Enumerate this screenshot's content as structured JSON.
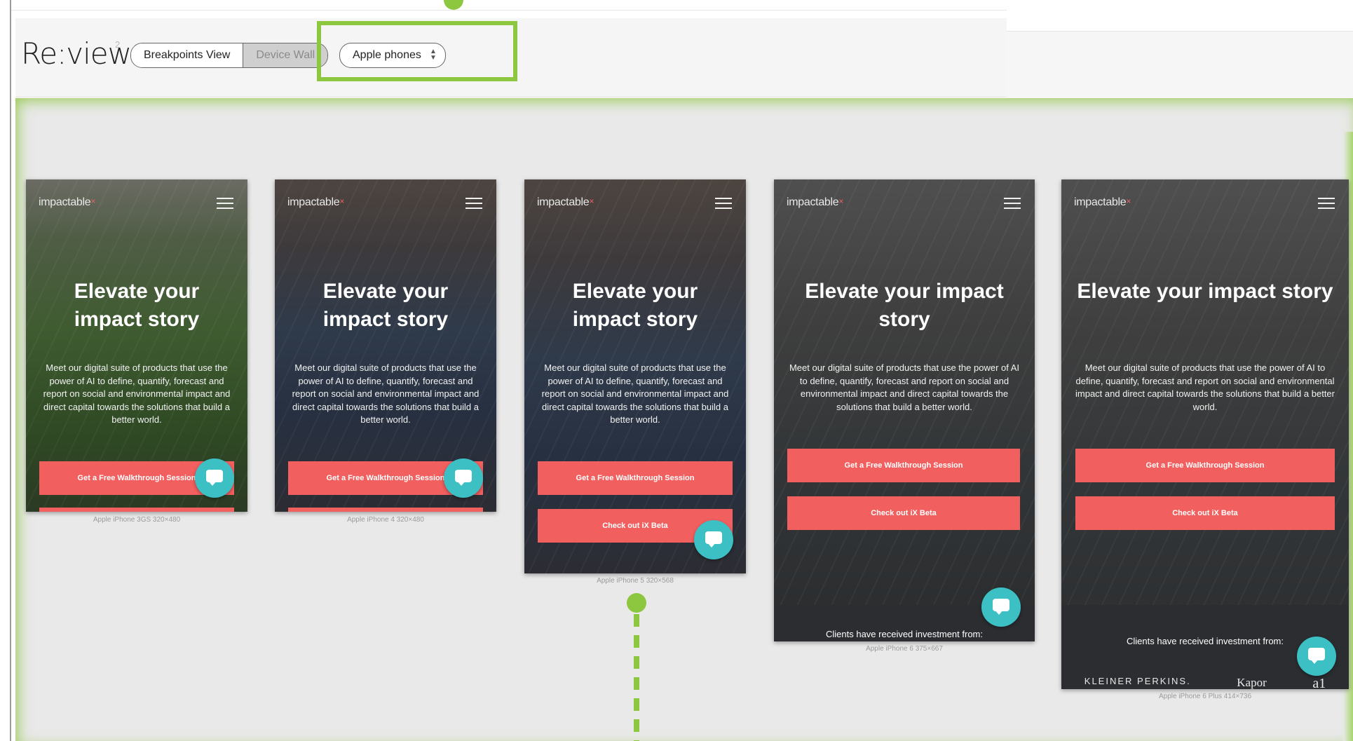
{
  "app": {
    "title": "Re:view",
    "sup": "2"
  },
  "view_toggle": {
    "option_a": "Breakpoints View",
    "option_b": "Device Wall"
  },
  "device_filter": {
    "value": "Apple phones"
  },
  "devices": [
    {
      "brand": "impactable",
      "brand_mark": "×",
      "headline": "Elevate your impact story",
      "body": "Meet our digital suite of products that use the power of AI to define, quantify, forecast and report on social and environmental impact and direct capital towards the solutions that build a better world.",
      "cta_primary": "Get a Free Walkthrough Session",
      "caption": "Apple iPhone 3GS   320×480"
    },
    {
      "brand": "impactable",
      "brand_mark": "×",
      "headline": "Elevate your impact story",
      "body": "Meet our digital suite of products that use the power of AI to define, quantify, forecast and report on social and environmental impact and direct capital towards the solutions that build a better world.",
      "cta_primary": "Get a Free Walkthrough Session",
      "caption": "Apple iPhone 4   320×480"
    },
    {
      "brand": "impactable",
      "brand_mark": "×",
      "headline": "Elevate your impact story",
      "body": "Meet our digital suite of products that use the power of AI to define, quantify, forecast and report on social and environmental impact and direct capital towards the solutions that build a better world.",
      "cta_primary": "Get a Free Walkthrough Session",
      "cta_secondary": "Check out iX Beta",
      "caption": "Apple iPhone 5   320×568"
    },
    {
      "brand": "impactable",
      "brand_mark": "×",
      "headline": "Elevate your impact story",
      "body": "Meet our digital suite of products that use the power of AI to define, quantify, forecast and report on social and environmental impact and direct capital towards the solutions that build a better world.",
      "cta_primary": "Get a Free Walkthrough Session",
      "cta_secondary": "Check out iX Beta",
      "clients_text": "Clients have received investment from:",
      "caption": "Apple iPhone 6   375×667"
    },
    {
      "brand": "impactable",
      "brand_mark": "×",
      "headline": "Elevate your impact story",
      "body": "Meet our digital suite of products that use the power of AI to define, quantify, forecast and report on social and environmental impact and direct capital towards the solutions that build a better world.",
      "cta_primary": "Get a Free Walkthrough Session",
      "cta_secondary": "Check out iX Beta",
      "clients_text": "Clients have received investment from:",
      "client_logos": [
        "KLEINER PERKINS.",
        "Kapor",
        "a1"
      ],
      "caption": "Apple iPhone 6 Plus   414×736"
    }
  ]
}
